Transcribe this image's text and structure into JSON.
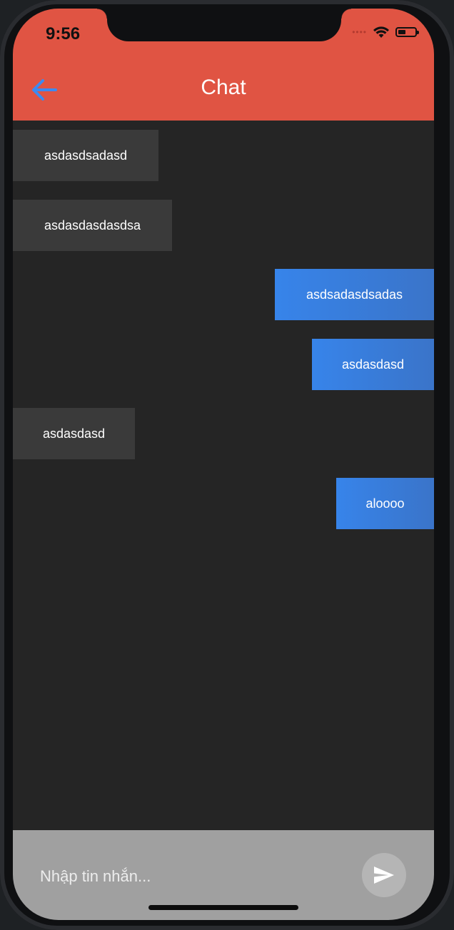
{
  "status_bar": {
    "time": "9:56",
    "icons": [
      "signal-dots-icon",
      "wifi-icon",
      "battery-icon"
    ]
  },
  "header": {
    "title": "Chat",
    "back_icon": "arrow-left-icon",
    "color": "#e05443"
  },
  "messages": [
    {
      "text": "asdasdsadasd",
      "direction": "incoming"
    },
    {
      "text": "asdasdasdasdsa",
      "direction": "incoming"
    },
    {
      "text": "asdsadasdsadas",
      "direction": "outgoing"
    },
    {
      "text": "asdasdasd",
      "direction": "outgoing"
    },
    {
      "text": "asdasdasd",
      "direction": "incoming"
    },
    {
      "text": "aloooo",
      "direction": "outgoing"
    }
  ],
  "composer": {
    "placeholder": "Nhập tin nhắn...",
    "value": "",
    "send_icon": "send-icon"
  },
  "colors": {
    "incoming_bubble": "#3a3a3a",
    "outgoing_bubble": "#3784ea",
    "background": "#252525",
    "composer": "#a0a0a0"
  }
}
